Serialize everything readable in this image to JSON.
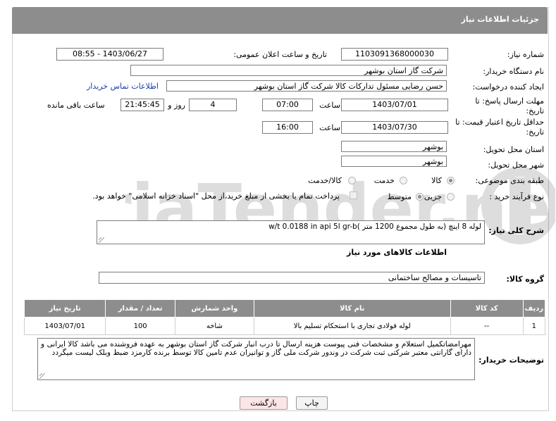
{
  "header": {
    "title": "جزئیات اطلاعات نیاز"
  },
  "fields": {
    "need_number_label": "شماره نیاز:",
    "need_number": "1103091368000030",
    "announce_label": "تاریخ و ساعت اعلان عمومی:",
    "announce_value": "1403/06/27 - 08:55",
    "buyer_org_label": "نام دستگاه خریدار:",
    "buyer_org": "شرکت گاز استان بوشهر",
    "requester_label": "ایجاد کننده درخواست:",
    "requester": "حسن رضایی مسئول تدارکات کالا شرکت گاز استان بوشهر",
    "contact_link": "اطلاعات تماس خریدار",
    "reply_deadline_label_1": "مهلت ارسال پاسخ: تا",
    "reply_deadline_label_2": "تاریخ:",
    "reply_date": "1403/07/01",
    "time_label": "ساعت",
    "reply_time": "07:00",
    "days_value": "4",
    "days_label": "روز و",
    "remaining_time": "21:45:45",
    "remaining_label": "ساعت باقی مانده",
    "price_validity_label_1": "حداقل تاریخ اعتبار قیمت: تا",
    "price_validity_label_2": "تاریخ:",
    "price_date": "1403/07/30",
    "price_time": "16:00",
    "province_label": "استان محل تحویل:",
    "province": "بوشهر",
    "city_label": "شهر محل تحویل:",
    "city": "بوشهر",
    "category_label": "طبقه بندی موضوعی:",
    "category_options": [
      "کالا",
      "خدمت",
      "کالا/خدمت"
    ],
    "process_label": "نوع فرآیند خرید :",
    "process_options": [
      "جزیی",
      "متوسط"
    ],
    "payment_note": "پرداخت تمام یا بخشی از مبلغ خرید،از محل \"اسناد خزانه اسلامی\" خواهد بود.",
    "summary_label": "شرح کلی نیاز:",
    "summary": "لوله 8 اینچ  (به طول مجموع 1200 متر )w/t 0.0188 in api 5l gr-b"
  },
  "goods": {
    "section_title": "اطلاعات کالاهای مورد نیاز",
    "group_label": "گروه کالا:",
    "group_value": "تاسیسات و مصالح ساختمانی",
    "columns": [
      "ردیف",
      "کد کالا",
      "نام کالا",
      "واحد شمارش",
      "تعداد / مقدار",
      "تاریخ نیاز"
    ],
    "rows": [
      [
        "1",
        "--",
        "لوله فولادی تجاری با استحکام تسلیم بالا",
        "شاخه",
        "100",
        "1403/07/01"
      ]
    ]
  },
  "buyer_notes": {
    "label": "توضیحات خریدار:",
    "text": "مهرامضاتکمیل استعلام و مشخصات فنی پیوست هزینه ارسال تا درب انبار شرکت گاز استان بوشهر به عهده فروشنده می باشد کالا ایرانی و دارای گارانتی معتبر شرکتی ثبت شرکت در وندور شرکت ملی گاز و توانیران عدم تامین کالا توسط برنده کارمزد ضبط وبلک لیست میگردد"
  },
  "buttons": {
    "print": "چاپ",
    "back": "بازگشت"
  },
  "colors": {
    "header_bg": "#8d8d8d",
    "link": "#1a3fa8",
    "back_btn_bg": "#fde5e5"
  }
}
